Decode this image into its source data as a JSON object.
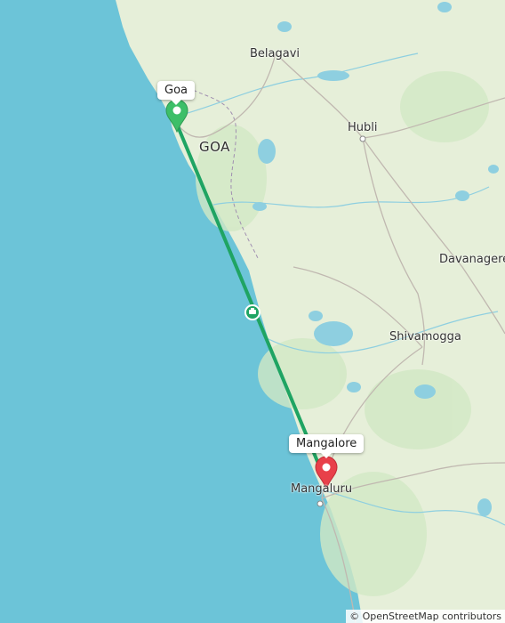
{
  "map": {
    "places": {
      "belagavi": "Belagavi",
      "goa_region": "GOA",
      "hubli": "Hubli",
      "davanagere": "Davanagere",
      "shivamogga": "Shivamogga",
      "mangaluru": "Mangaluru"
    },
    "route": {
      "origin": "Goa",
      "destination": "Mangalore",
      "mode_icon": "ferry-icon",
      "line_color": "#1fa463"
    },
    "markers": {
      "origin_color": "#3dbf68",
      "destination_color": "#e8404a"
    },
    "attribution": "© OpenStreetMap contributors"
  }
}
